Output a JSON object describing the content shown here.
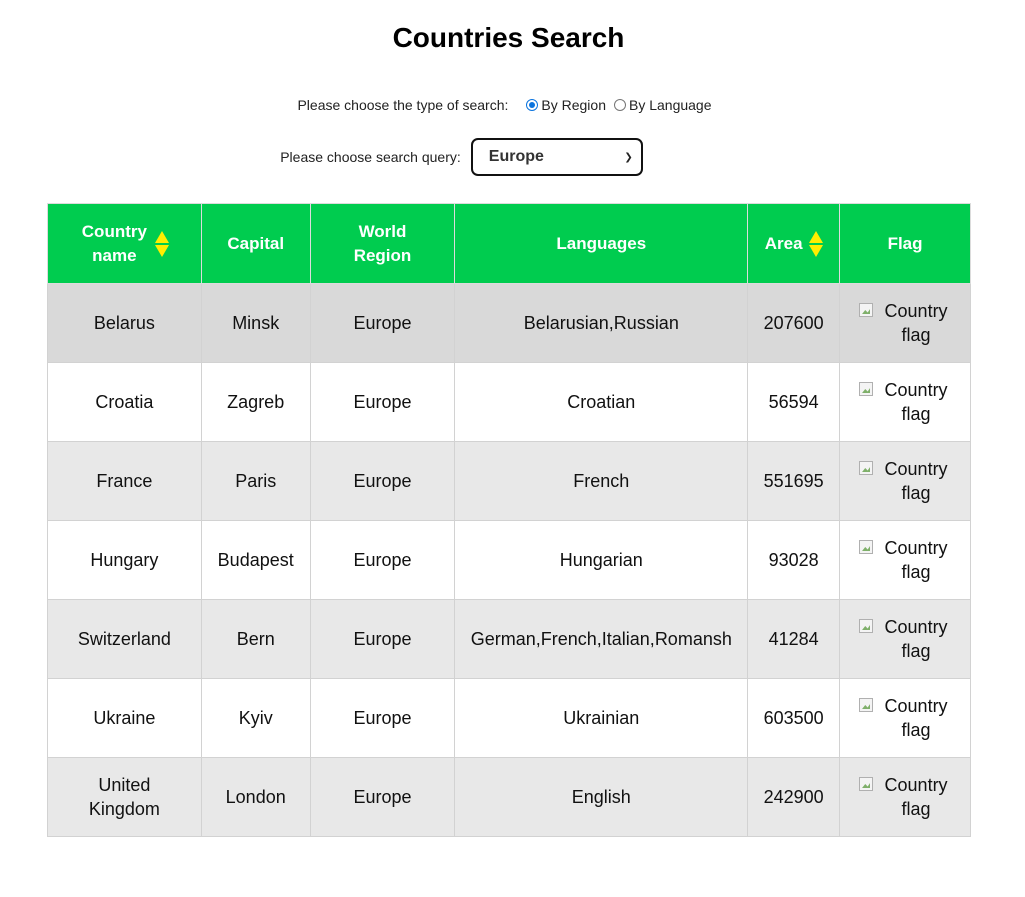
{
  "page": {
    "title": "Countries Search"
  },
  "search_type": {
    "label": "Please choose the type of search:",
    "options": [
      {
        "label": "By Region",
        "checked": true
      },
      {
        "label": "By Language",
        "checked": false
      }
    ]
  },
  "query": {
    "label": "Please choose search query:",
    "selected": "Europe"
  },
  "table": {
    "headers": {
      "country_name": "Country name",
      "capital": "Capital",
      "world_region": "World Region",
      "languages": "Languages",
      "area": "Area",
      "flag": "Flag"
    },
    "rows": [
      {
        "name": "Belarus",
        "capital": "Minsk",
        "region": "Europe",
        "languages": "Belarusian,Russian",
        "area": "207600",
        "flag_alt": "Country flag"
      },
      {
        "name": "Croatia",
        "capital": "Zagreb",
        "region": "Europe",
        "languages": "Croatian",
        "area": "56594",
        "flag_alt": "Country flag"
      },
      {
        "name": "France",
        "capital": "Paris",
        "region": "Europe",
        "languages": "French",
        "area": "551695",
        "flag_alt": "Country flag"
      },
      {
        "name": "Hungary",
        "capital": "Budapest",
        "region": "Europe",
        "languages": "Hungarian",
        "area": "93028",
        "flag_alt": "Country flag"
      },
      {
        "name": "Switzerland",
        "capital": "Bern",
        "region": "Europe",
        "languages": "German,French,Italian,Romansh",
        "area": "41284",
        "flag_alt": "Country flag"
      },
      {
        "name": "Ukraine",
        "capital": "Kyiv",
        "region": "Europe",
        "languages": "Ukrainian",
        "area": "603500",
        "flag_alt": "Country flag"
      },
      {
        "name": "United Kingdom",
        "capital": "London",
        "region": "Europe",
        "languages": "English",
        "area": "242900",
        "flag_alt": "Country flag"
      }
    ]
  },
  "colors": {
    "header_bg": "#00cc4f",
    "sort_icon": "#ffee00",
    "radio_accent": "#0b74de"
  },
  "icons": {
    "sort": "sort-icon",
    "broken_image": "broken-image-icon"
  }
}
